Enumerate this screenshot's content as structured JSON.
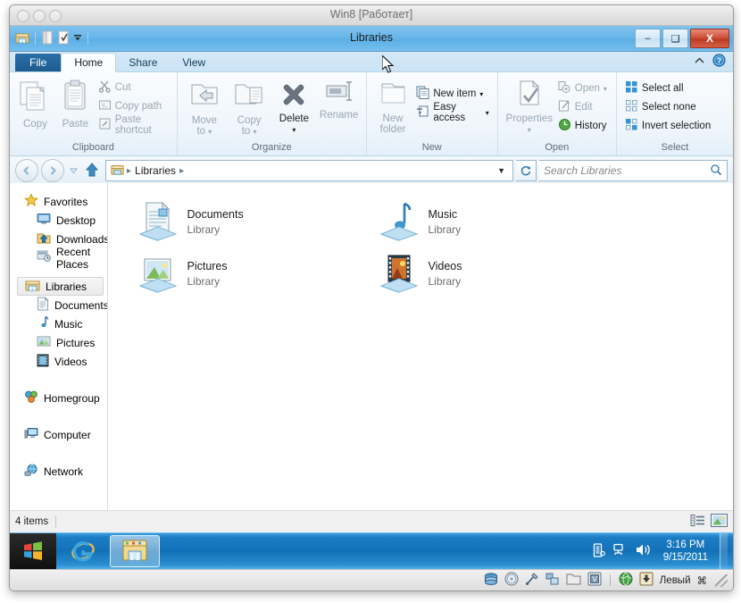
{
  "vm": {
    "title": "Win8 [Работает]",
    "statusbar": {
      "keyboard_host": "Левый",
      "host_key_glyph": "⌘",
      "icons": [
        "harddisk-icon",
        "optical-disk-icon",
        "usb-icon",
        "network-icon",
        "shared-folder-icon",
        "display-icon",
        "globe-icon",
        "mouse-capture-icon"
      ]
    }
  },
  "explorer": {
    "title": "Libraries",
    "quick_access": {
      "icons": [
        "libraries-icon",
        "properties-icon",
        "new-folder-icon",
        "customize-qat-dropdown-icon"
      ]
    },
    "window_buttons": {
      "minimize": "–",
      "maximize": "❑",
      "close": "X"
    },
    "tabs": [
      {
        "label": "File",
        "type": "file"
      },
      {
        "label": "Home",
        "type": "active"
      },
      {
        "label": "Share",
        "type": "normal"
      },
      {
        "label": "View",
        "type": "normal"
      }
    ],
    "ribbon_help": {
      "collapse_icon": "chevron-up-icon",
      "help_icon": "help-icon"
    },
    "ribbon_groups": [
      {
        "label": "Clipboard",
        "big_buttons": [
          {
            "label": "Copy",
            "icon": "copy-icon",
            "enabled": false
          },
          {
            "label": "Paste",
            "icon": "paste-icon",
            "enabled": false
          }
        ],
        "small_buttons": [
          {
            "label": "Cut",
            "icon": "cut-scissors-icon",
            "enabled": false
          },
          {
            "label": "Copy path",
            "icon": "copy-path-icon",
            "enabled": false
          },
          {
            "label": "Paste shortcut",
            "icon": "paste-shortcut-icon",
            "enabled": false
          }
        ]
      },
      {
        "label": "Organize",
        "big_buttons": [
          {
            "label": "Move to",
            "icon": "move-to-icon",
            "enabled": false,
            "dropdown": true
          },
          {
            "label": "Copy to",
            "icon": "copy-to-icon",
            "enabled": false,
            "dropdown": true
          },
          {
            "label": "Delete",
            "icon": "delete-x-icon",
            "enabled": true,
            "dropdown": true
          },
          {
            "label": "Rename",
            "icon": "rename-icon",
            "enabled": false
          }
        ],
        "small_buttons": []
      },
      {
        "label": "New",
        "big_buttons": [
          {
            "label": "New folder",
            "icon": "new-folder-icon",
            "enabled": false
          }
        ],
        "small_buttons": [
          {
            "label": "New item",
            "icon": "new-item-icon",
            "enabled": true,
            "dropdown": true
          },
          {
            "label": "Easy access",
            "icon": "easy-access-icon",
            "enabled": true,
            "dropdown": true
          }
        ]
      },
      {
        "label": "Open",
        "big_buttons": [
          {
            "label": "Properties",
            "icon": "properties-icon",
            "enabled": false,
            "dropdown": true
          }
        ],
        "small_buttons": [
          {
            "label": "Open",
            "icon": "open-icon",
            "enabled": false,
            "dropdown": true
          },
          {
            "label": "Edit",
            "icon": "edit-icon",
            "enabled": false
          },
          {
            "label": "History",
            "icon": "history-icon",
            "enabled": true
          }
        ]
      },
      {
        "label": "Select",
        "big_buttons": [],
        "small_buttons": [
          {
            "label": "Select all",
            "icon": "select-all-icon",
            "enabled": true
          },
          {
            "label": "Select none",
            "icon": "select-none-icon",
            "enabled": true
          },
          {
            "label": "Invert selection",
            "icon": "invert-selection-icon",
            "enabled": true
          }
        ]
      }
    ],
    "address_bar": {
      "back_icon": "back-arrow-icon",
      "forward_icon": "forward-arrow-icon",
      "history_icon": "recent-locations-dropdown-icon",
      "up_icon": "up-arrow-icon",
      "crumb_icon": "libraries-icon",
      "crumbs": [
        "Libraries"
      ],
      "dropdown_icon": "chevron-down-icon",
      "refresh_icon": "refresh-icon"
    },
    "search": {
      "placeholder": "Search Libraries",
      "icon": "search-icon"
    },
    "nav_pane": [
      {
        "label": "Favorites",
        "icon": "favorites-star-icon",
        "level": "root",
        "selected": false
      },
      {
        "label": "Desktop",
        "icon": "desktop-icon",
        "level": "child",
        "selected": false
      },
      {
        "label": "Downloads",
        "icon": "downloads-icon",
        "level": "child",
        "selected": false
      },
      {
        "label": "Recent Places",
        "icon": "recent-places-icon",
        "level": "child",
        "selected": false
      },
      {
        "label": "Libraries",
        "icon": "libraries-icon",
        "level": "root",
        "selected": true
      },
      {
        "label": "Documents",
        "icon": "documents-library-icon",
        "level": "child",
        "selected": false
      },
      {
        "label": "Music",
        "icon": "music-library-icon",
        "level": "child",
        "selected": false
      },
      {
        "label": "Pictures",
        "icon": "pictures-library-icon",
        "level": "child",
        "selected": false
      },
      {
        "label": "Videos",
        "icon": "videos-library-icon",
        "level": "child",
        "selected": false
      },
      {
        "label": "Homegroup",
        "icon": "homegroup-icon",
        "level": "root",
        "selected": false
      },
      {
        "label": "Computer",
        "icon": "computer-icon",
        "level": "root",
        "selected": false
      },
      {
        "label": "Network",
        "icon": "network-icon",
        "level": "root",
        "selected": false
      }
    ],
    "items": [
      {
        "name": "Documents",
        "sub": "Library",
        "icon": "documents-library-icon"
      },
      {
        "name": "Music",
        "sub": "Library",
        "icon": "music-library-icon"
      },
      {
        "name": "Pictures",
        "sub": "Library",
        "icon": "pictures-library-icon"
      },
      {
        "name": "Videos",
        "sub": "Library",
        "icon": "videos-library-icon"
      }
    ],
    "status": {
      "count": "4 items",
      "view_details_icon": "details-view-icon",
      "view_large_icon": "large-icons-view-icon"
    }
  },
  "taskbar": {
    "start_icon": "windows-start-orb-icon",
    "items": [
      {
        "icon": "internet-explorer-icon",
        "active": false
      },
      {
        "icon": "file-explorer-icon",
        "active": true
      }
    ],
    "tray_icons": [
      "action-center-icon",
      "network-icon",
      "volume-icon"
    ],
    "clock": {
      "time": "3:16 PM",
      "date": "9/15/2011"
    }
  },
  "colors": {
    "titlebar_blue": "#68b6e9",
    "taskbar_blue": "#1371b8",
    "file_tab_blue": "#1d5c90",
    "close_red": "#bd3b21",
    "selection_grey": "#eaeaea"
  }
}
